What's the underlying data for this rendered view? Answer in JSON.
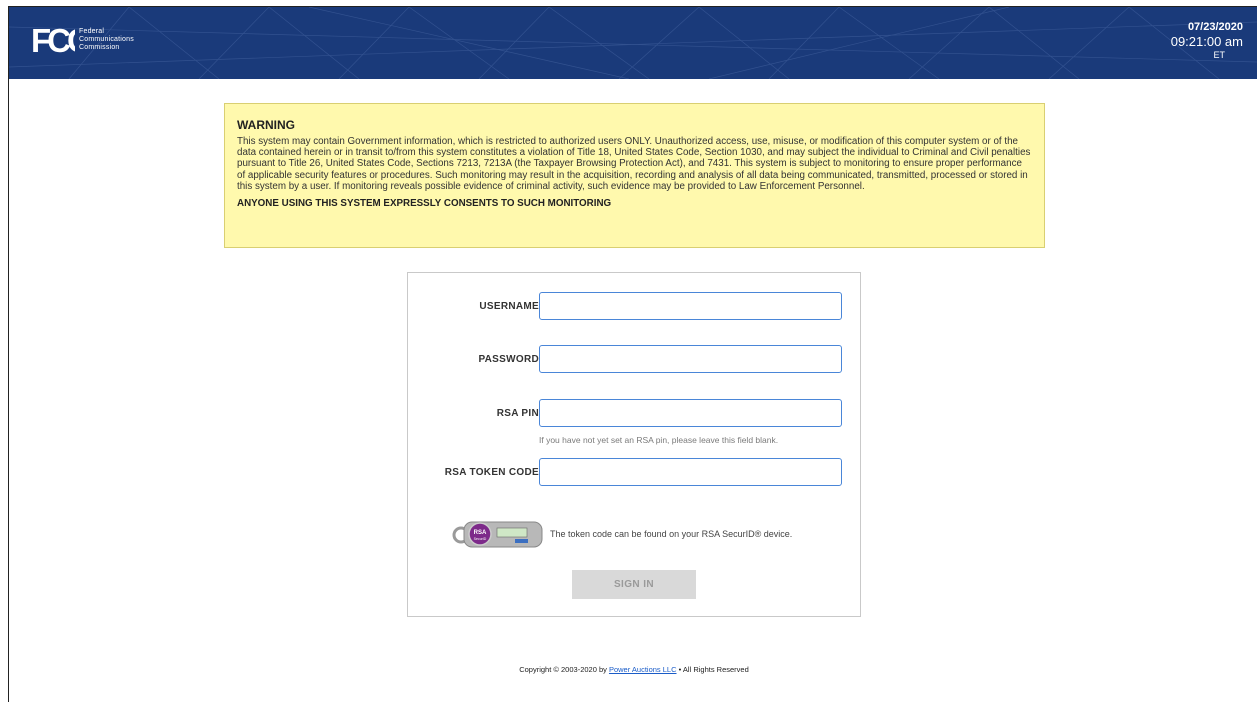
{
  "header": {
    "logo": {
      "mark": "FCC",
      "line1": "Federal",
      "line2": "Communications",
      "line3": "Commission"
    },
    "clock": {
      "date": "07/23/2020",
      "time": "09:21:00 am",
      "timezone": "ET"
    },
    "colors": {
      "background": "#1a3a7a"
    }
  },
  "warning": {
    "title": "WARNING",
    "body": "This system may contain Government information, which is restricted to authorized users ONLY. Unauthorized access, use, misuse, or modification of this computer system or of the data contained herein or in transit to/from this system constitutes a violation of Title 18, United States Code, Section 1030, and may subject the individual to Criminal and Civil penalties pursuant to Title 26, United States Code, Sections 7213, 7213A (the Taxpayer Browsing Protection Act), and 7431. This system is subject to monitoring to ensure proper performance of applicable security features or procedures. Such monitoring may result in the acquisition, recording and analysis of all data being communicated, transmitted, processed or stored in this system by a user. If monitoring reveals possible evidence of criminal activity, such evidence may be provided to Law Enforcement Personnel.",
    "consent": "ANYONE USING THIS SYSTEM EXPRESSLY CONSENTS TO SUCH MONITORING",
    "colors": {
      "background": "#fff9ad",
      "border": "#d9cf72"
    }
  },
  "login": {
    "username_label": "USERNAME",
    "username_value": "",
    "password_label": "PASSWORD",
    "password_value": "",
    "rsa_pin_label": "RSA PIN",
    "rsa_pin_value": "",
    "rsa_pin_hint": "If you have not yet set an RSA pin, please leave this field blank.",
    "rsa_token_label": "RSA TOKEN CODE",
    "rsa_token_value": "",
    "token_info": "The token code can be found on your RSA SecurID® device.",
    "token_device_brand": "RSA",
    "token_device_sub": "SecurID",
    "sign_in_label": "SIGN IN",
    "colors": {
      "field_border": "#4a86d8",
      "button_bg": "#d9d9d9"
    }
  },
  "footer": {
    "prefix": "Copyright © 2003-2020 by ",
    "link": "Power Auctions LLC",
    "suffix": " • All Rights Reserved"
  }
}
